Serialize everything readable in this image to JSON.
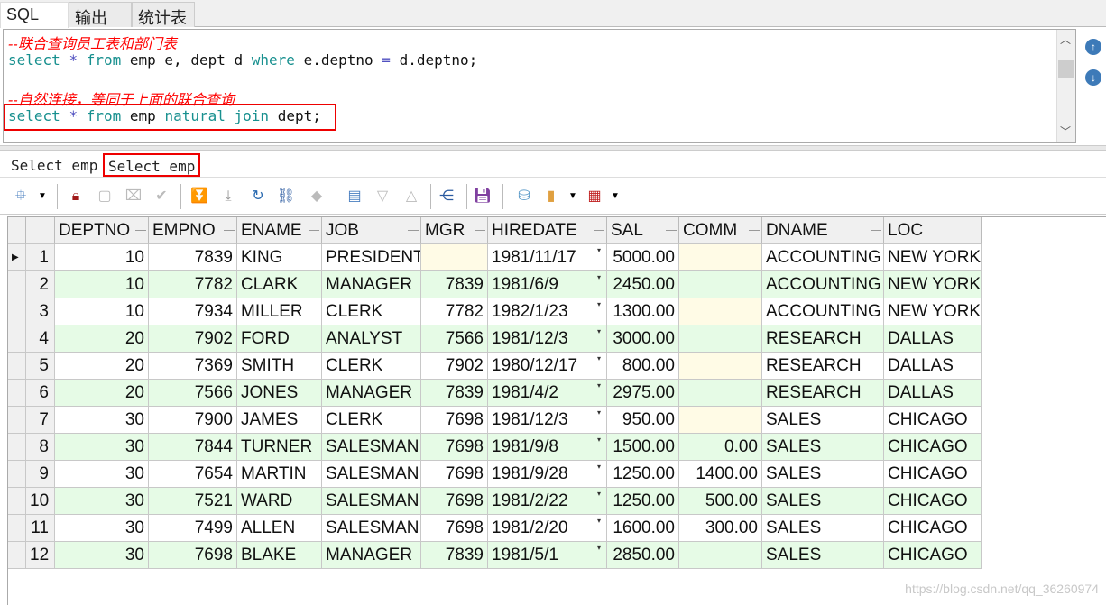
{
  "top_tabs": [
    {
      "label": "SQL",
      "active": true
    },
    {
      "label": "输出",
      "active": false
    },
    {
      "label": "统计表",
      "active": false
    }
  ],
  "editor": {
    "comment1": "--联合查询员工表和部门表",
    "q1": {
      "select": "select",
      "star": "*",
      "from": "from",
      "t1": "emp e,",
      "t2": "dept d",
      "where": "where",
      "cond1": "e.deptno",
      "eq": "=",
      "cond2": "d.deptno;"
    },
    "comment2": "--自然连接，等同于上面的联合查询",
    "q2": {
      "select": "select",
      "star": "*",
      "from": "from",
      "t1": "emp",
      "natural": "natural",
      "join": "join",
      "t2": "dept;"
    }
  },
  "result_tabs": [
    {
      "label": "Select emp",
      "active": false
    },
    {
      "label": "Select emp",
      "active": true
    }
  ],
  "toolbar_icons": [
    "select-mode-icon",
    "dropdown-icon",
    "lock-icon",
    "new-record-icon",
    "delete-record-icon",
    "post-icon",
    "last-icon",
    "first-icon",
    "refresh-icon",
    "find-icon",
    "clear-icon",
    "export-icon",
    "next-icon",
    "prev-icon",
    "tree-icon",
    "save-icon",
    "upload-icon",
    "chart-icon",
    "dropdown-icon",
    "table-icon",
    "dropdown-icon"
  ],
  "colors": {
    "accent_red": "#e00000",
    "row_alt": "#e6fbe6",
    "null_cell": "#fffbe6",
    "keyword": "#18908f",
    "comment": "#ff0000"
  },
  "grid": {
    "columns": [
      "DEPTNO",
      "EMPNO",
      "ENAME",
      "JOB",
      "MGR",
      "HIREDATE",
      "SAL",
      "COMM",
      "DNAME",
      "LOC"
    ],
    "rows": [
      [
        "10",
        "7839",
        "KING",
        "PRESIDENT",
        "",
        "1981/11/17",
        "5000.00",
        "",
        "ACCOUNTING",
        "NEW YORK"
      ],
      [
        "10",
        "7782",
        "CLARK",
        "MANAGER",
        "7839",
        "1981/6/9",
        "2450.00",
        "",
        "ACCOUNTING",
        "NEW YORK"
      ],
      [
        "10",
        "7934",
        "MILLER",
        "CLERK",
        "7782",
        "1982/1/23",
        "1300.00",
        "",
        "ACCOUNTING",
        "NEW YORK"
      ],
      [
        "20",
        "7902",
        "FORD",
        "ANALYST",
        "7566",
        "1981/12/3",
        "3000.00",
        "",
        "RESEARCH",
        "DALLAS"
      ],
      [
        "20",
        "7369",
        "SMITH",
        "CLERK",
        "7902",
        "1980/12/17",
        "800.00",
        "",
        "RESEARCH",
        "DALLAS"
      ],
      [
        "20",
        "7566",
        "JONES",
        "MANAGER",
        "7839",
        "1981/4/2",
        "2975.00",
        "",
        "RESEARCH",
        "DALLAS"
      ],
      [
        "30",
        "7900",
        "JAMES",
        "CLERK",
        "7698",
        "1981/12/3",
        "950.00",
        "",
        "SALES",
        "CHICAGO"
      ],
      [
        "30",
        "7844",
        "TURNER",
        "SALESMAN",
        "7698",
        "1981/9/8",
        "1500.00",
        "0.00",
        "SALES",
        "CHICAGO"
      ],
      [
        "30",
        "7654",
        "MARTIN",
        "SALESMAN",
        "7698",
        "1981/9/28",
        "1250.00",
        "1400.00",
        "SALES",
        "CHICAGO"
      ],
      [
        "30",
        "7521",
        "WARD",
        "SALESMAN",
        "7698",
        "1981/2/22",
        "1250.00",
        "500.00",
        "SALES",
        "CHICAGO"
      ],
      [
        "30",
        "7499",
        "ALLEN",
        "SALESMAN",
        "7698",
        "1981/2/20",
        "1600.00",
        "300.00",
        "SALES",
        "CHICAGO"
      ],
      [
        "30",
        "7698",
        "BLAKE",
        "MANAGER",
        "7839",
        "1981/5/1",
        "2850.00",
        "",
        "SALES",
        "CHICAGO"
      ]
    ]
  },
  "watermark": "https://blog.csdn.net/qq_36260974"
}
